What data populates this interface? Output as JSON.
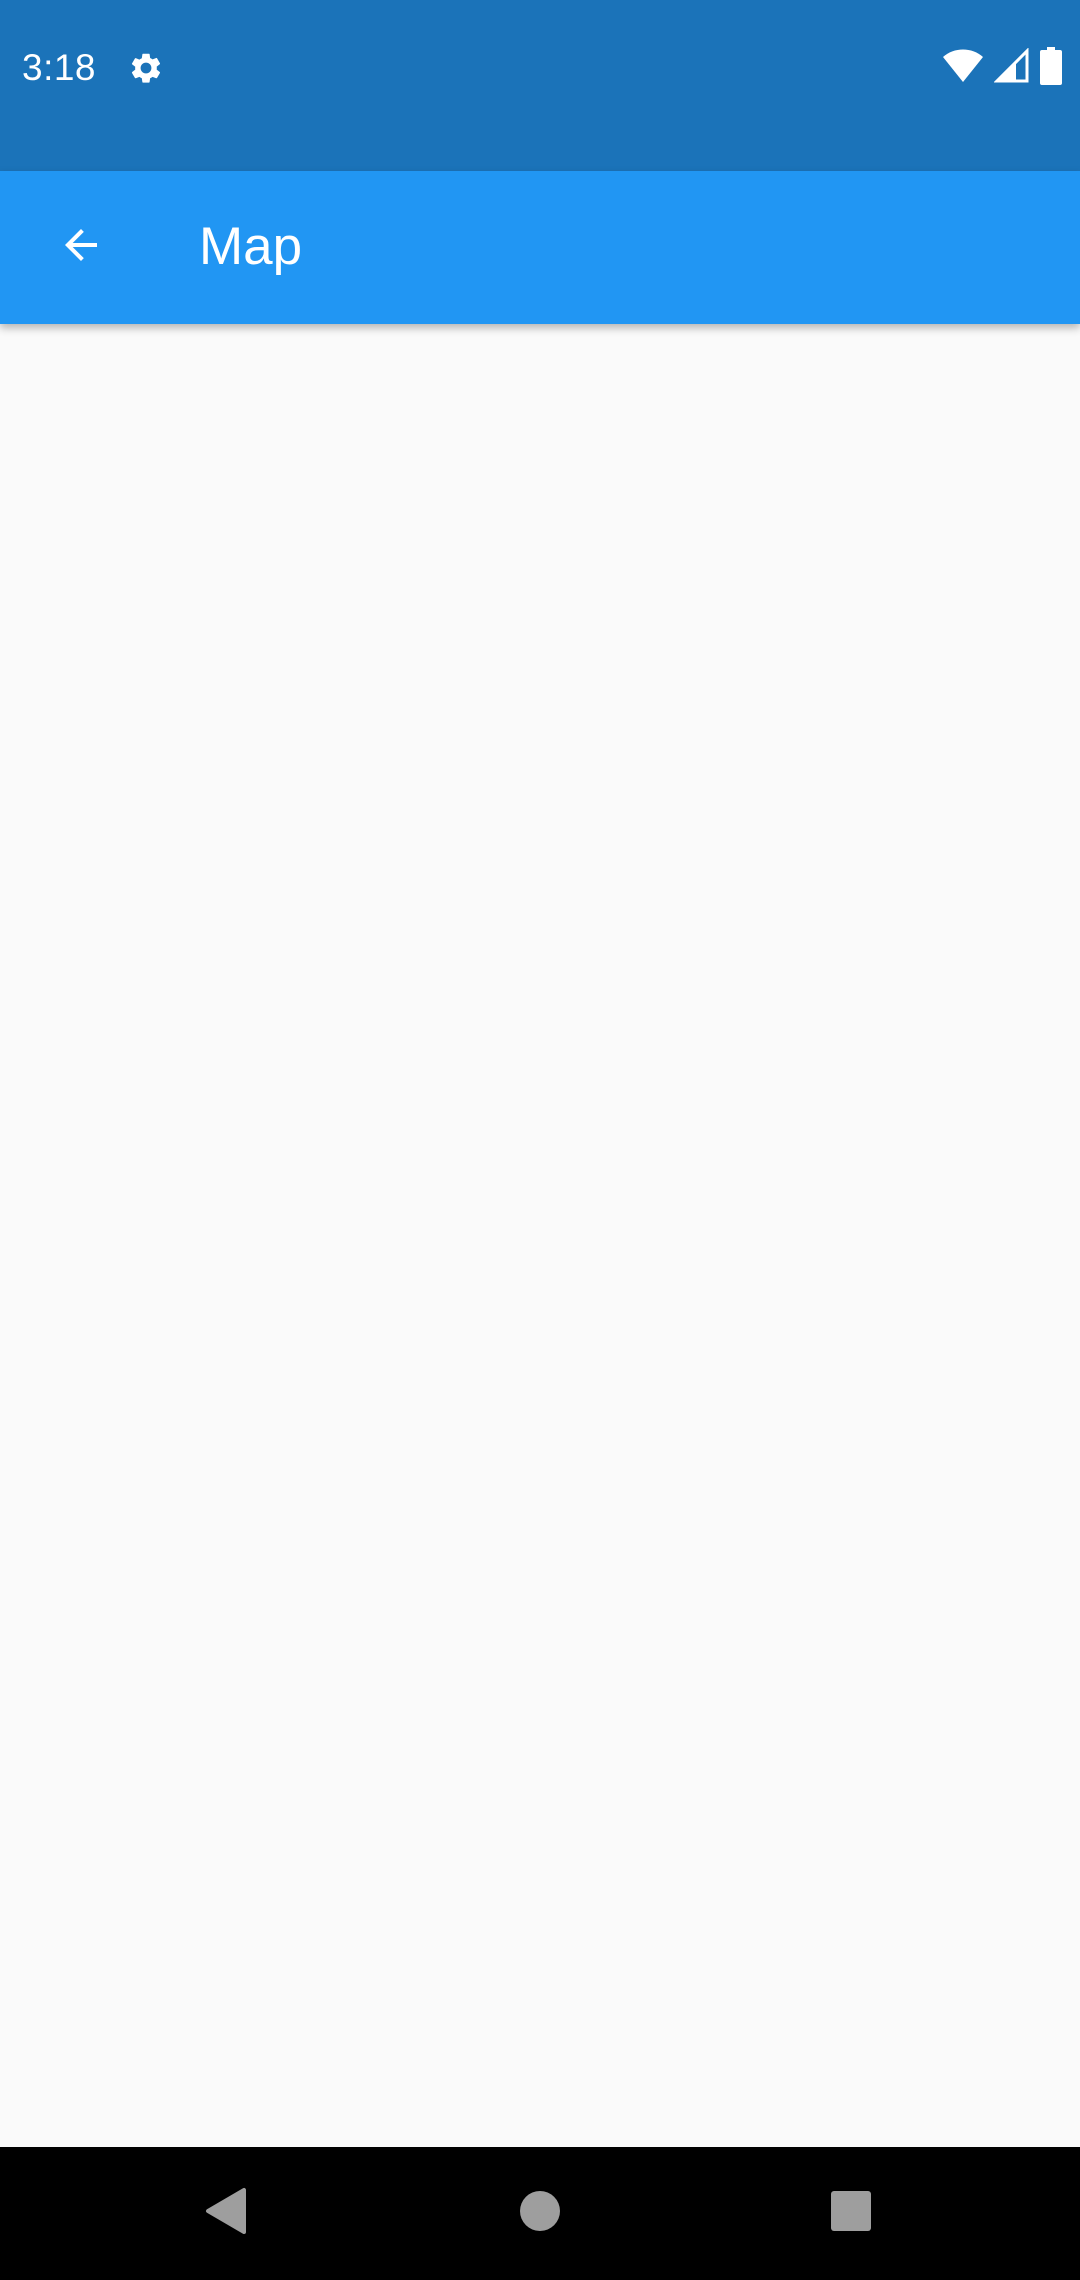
{
  "status_bar": {
    "time": "3:18",
    "icons": [
      "gear-icon",
      "wifi-icon",
      "cellular-signal-icon",
      "battery-icon"
    ]
  },
  "app_bar": {
    "title": "Map",
    "back_icon": "arrow-back-icon"
  },
  "nav_bar": {
    "icons": [
      "nav-back-icon",
      "nav-home-icon",
      "nav-recents-icon"
    ]
  },
  "colors": {
    "status_bar": "#1b73b9",
    "app_bar": "#2196f3",
    "background": "#fafafa",
    "nav_bar": "#000000",
    "nav_icons": "#9e9e9e"
  }
}
